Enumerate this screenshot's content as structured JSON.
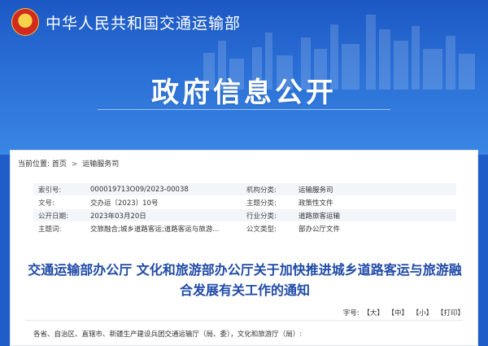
{
  "header": {
    "ministry_name": "中华人民共和国交通运输部",
    "page_heading": "政府信息公开",
    "emblem_icon": "national-emblem-icon"
  },
  "breadcrumb": {
    "prefix": "当前位置:",
    "items": [
      "首页",
      "运输服务司"
    ],
    "separator": ">"
  },
  "meta": {
    "rows": [
      {
        "k1": "索引号:",
        "v1": "000019713O09/2023-00038",
        "k2": "机构分类:",
        "v2": "运输服务司"
      },
      {
        "k1": "文号:",
        "v1": "交办运〔2023〕10号",
        "k2": "主题分类:",
        "v2": "政策性文件"
      },
      {
        "k1": "公开日期:",
        "v1": "2023年03月20日",
        "k2": "行业分类:",
        "v2": "道路旅客运输"
      },
      {
        "k1": "主题词:",
        "v1": "交旅融合;城乡道路客运;道路客运与旅游...",
        "k2": "公文类型:",
        "v2": "部办公厅文件"
      }
    ]
  },
  "document": {
    "title_line1": "交通运输部办公厅 文化和旅游部办公厅关于加快推进城乡道路客运与旅游融",
    "title_line2": "合发展有关工作的通知",
    "font_size_label": "字号:",
    "font_large": "【大】",
    "font_medium": "【中】",
    "font_small": "【小】",
    "print_label": "【打印】",
    "first_line": "各省、自治区、直辖市、新疆生产建设兵团交通运输厅（局、委），文化和旅游厅（局）:"
  },
  "colors": {
    "banner": "#2a6fd6",
    "title": "#1f4aa8",
    "table_stripe": "#f2f5fa"
  }
}
